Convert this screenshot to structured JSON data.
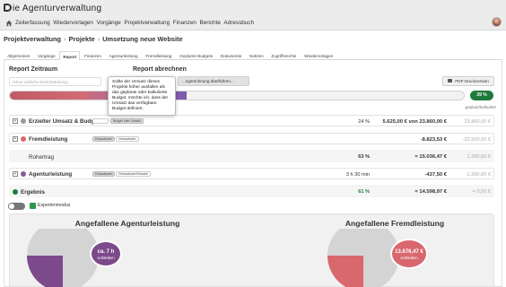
{
  "app": {
    "logo_initial": "D",
    "logo_text": "ie Agenturverwaltung"
  },
  "nav": {
    "home_icon": "home-icon",
    "items": [
      "Zeiterfassung",
      "Wiedervorlagen",
      "Vorgänge",
      "Projektverwaltung",
      "Finanzen",
      "Berichte",
      "Adressbuch"
    ]
  },
  "breadcrumb": [
    "Projektverwaltung",
    "Projekte",
    "Umsetzung neue Website"
  ],
  "tabs": [
    "Allgemeines",
    "Vorgänge",
    "Report",
    "Finanzen",
    "Agenturleistung",
    "Fremdleistung",
    "Geplante Budgets",
    "Dokumente",
    "Notizen",
    "Zugriffsrechte",
    "Wiedervorlagen"
  ],
  "active_tab": "Report",
  "report": {
    "zeitraum_title": "Report Zeitraum",
    "zeitraum_placeholder": "Ohne zeitliche Einschränkung...",
    "abrechnen_title": "Report abrechnen",
    "abrechnen_button": "...ngsrechnung überführen...",
    "pdf_button": "PDF-Druckversion",
    "progress_percent": 39,
    "progress_label": "39 %",
    "column_label": "geplant/kalkuliert"
  },
  "tooltip": "Sollte der Umsatz dieses Projekts höher ausfallen als das geplante oder kalkulierte Budget, möchte ich, dass der Umsatz das verfügbare Budget definiert.",
  "rows": [
    {
      "label": "Erzielter Umsatz & Budget",
      "dot_color": "#9a9a9a",
      "percent": "24 %",
      "hours": "",
      "amount": "5.625,00 € von 23.860,00 €",
      "ref": "23.860,00 €",
      "pills": [
        "",
        "Budget oder Umsatz"
      ]
    },
    {
      "label": "Fremdleistung",
      "dot_color": "#d9676e",
      "percent": "",
      "hours": "",
      "amount": "-8.823,53 €",
      "ref": "-22.500,00 €",
      "pills": [
        "Einkaufswert",
        "Verkaufswert"
      ]
    },
    {
      "label": "Rohertrag",
      "dot_color": "",
      "percent": "63 %",
      "hours": "",
      "amount": "= 15.036,47 €",
      "ref": "1.360,00 €",
      "pills": []
    },
    {
      "label": "Agenturleistung",
      "dot_color": "#8a5a9a",
      "percent": "",
      "hours": "3 h 30 min",
      "amount": "-437,50 €",
      "ref": "-1.360,00 €",
      "pills": [
        "Einkaufswert",
        "Verkaufswert/Stunden"
      ]
    },
    {
      "label": "Ergebnis",
      "dot_color": "#1e7a3a",
      "percent": "61 %",
      "hours": "",
      "amount": "= 14.598,97 €",
      "ref": "= 0,00 €",
      "pills": []
    }
  ],
  "expert_mode": {
    "label": "Expertenmodus",
    "toggle_on": false,
    "checked": true
  },
  "charts": {
    "left": {
      "title": "Angefallene Agenturleistung",
      "center_value": "ca. 7 h",
      "center_sub": "verbleiben",
      "fill_color": "#7c4a8a",
      "center_color": "#7c4a8a"
    },
    "right": {
      "title": "Angefallene Fremdleistung",
      "center_value": "13.676,47 €",
      "center_sub": "verbleiben",
      "fill_color": "#d9676e",
      "center_color": "#d9676e"
    }
  }
}
